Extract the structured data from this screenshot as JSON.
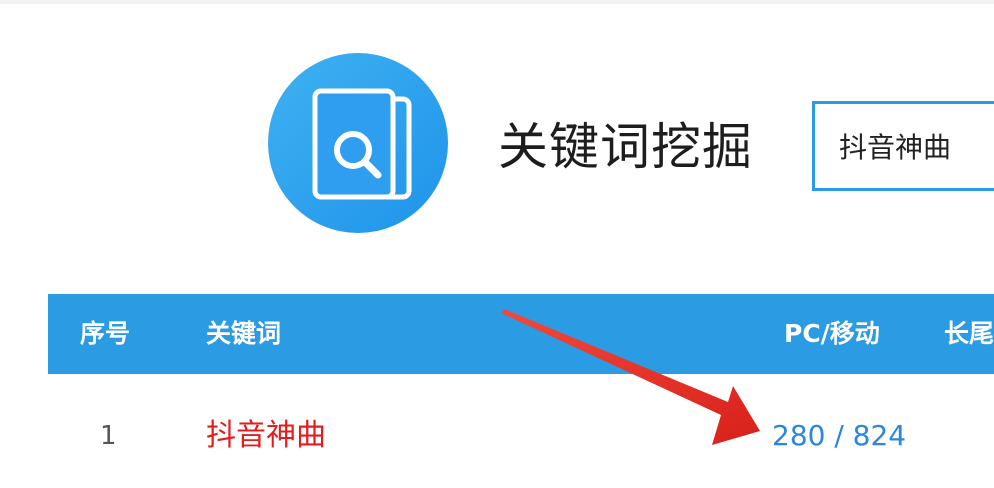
{
  "header": {
    "logo_icon": "keyword-search-book-icon",
    "title": "关键词挖掘"
  },
  "search": {
    "value": "抖音神曲",
    "accent_color": "#2b9ae6"
  },
  "table": {
    "header_color": "#2b9be3",
    "columns": [
      "序号",
      "关键词",
      "PC/移动",
      "长尾"
    ],
    "rows": [
      {
        "index": "1",
        "keyword": "抖音神曲",
        "pc_mobile": "280 / 824"
      }
    ]
  },
  "annotation": {
    "arrow_icon": "red-arrow-icon",
    "color": "#e8302a"
  }
}
